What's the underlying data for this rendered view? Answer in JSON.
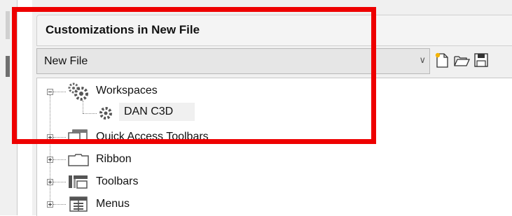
{
  "header": {
    "title": "Customizations in New File"
  },
  "file_selector": {
    "value": "New File"
  },
  "toolbar": {
    "icons": [
      "new-file-icon",
      "open-folder-icon",
      "save-icon"
    ]
  },
  "tree": {
    "workspaces": {
      "label": "Workspaces",
      "children": [
        {
          "label": "DAN C3D"
        }
      ]
    },
    "quick_access": {
      "label": "Quick Access Toolbars"
    },
    "ribbon": {
      "label": "Ribbon"
    },
    "toolbars": {
      "label": "Toolbars"
    },
    "menus": {
      "label": "Menus"
    }
  },
  "colors": {
    "highlight_frame": "#ee0000",
    "panel_bg": "#f0f0f0"
  }
}
